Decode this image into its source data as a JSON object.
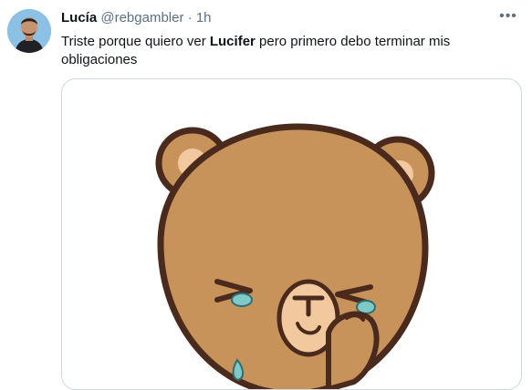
{
  "tweet": {
    "author_name": "Lucía",
    "author_handle": "@rebgambler",
    "separator": "·",
    "time": "1h",
    "more_icon": "more-horizontal-icon",
    "text_before": "Triste porque quiero ver ",
    "text_bold": "Lucifer",
    "text_after": " pero primero debo terminar mis obligaciones"
  },
  "media": {
    "type": "gif",
    "subject": "crying-bear",
    "colors": {
      "fur": "#c8925b",
      "outline": "#4a2a1c",
      "muzzle": "#f2c99e",
      "tear": "#7fc9c6"
    }
  },
  "colors": {
    "text": "#0f1419",
    "secondary": "#5b7083",
    "border": "#cfd9de"
  }
}
